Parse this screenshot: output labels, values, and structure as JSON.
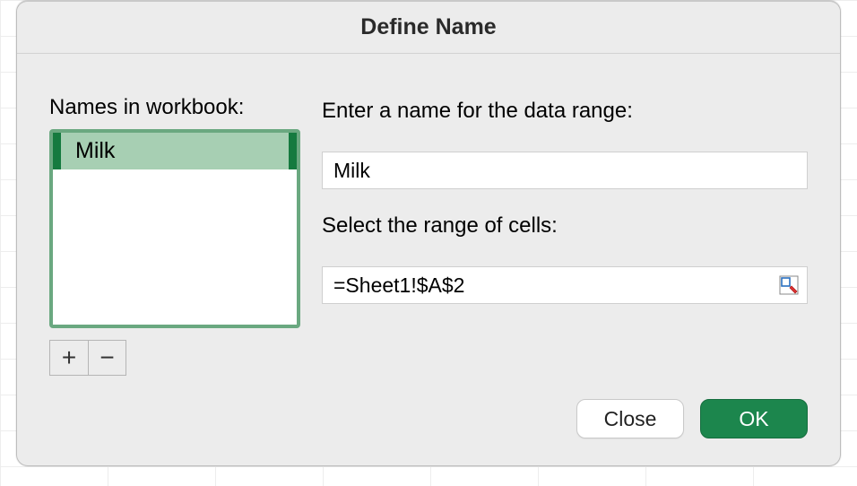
{
  "dialog": {
    "title": "Define Name"
  },
  "names_section": {
    "label": "Names in workbook:",
    "items": [
      {
        "label": "Milk"
      }
    ],
    "add_label": "+",
    "remove_label": "−"
  },
  "name_field": {
    "label": "Enter a name for the data range:",
    "value": "Milk"
  },
  "range_field": {
    "label": "Select the range of cells:",
    "value": "=Sheet1!$A$2"
  },
  "buttons": {
    "close": "Close",
    "ok": "OK"
  }
}
